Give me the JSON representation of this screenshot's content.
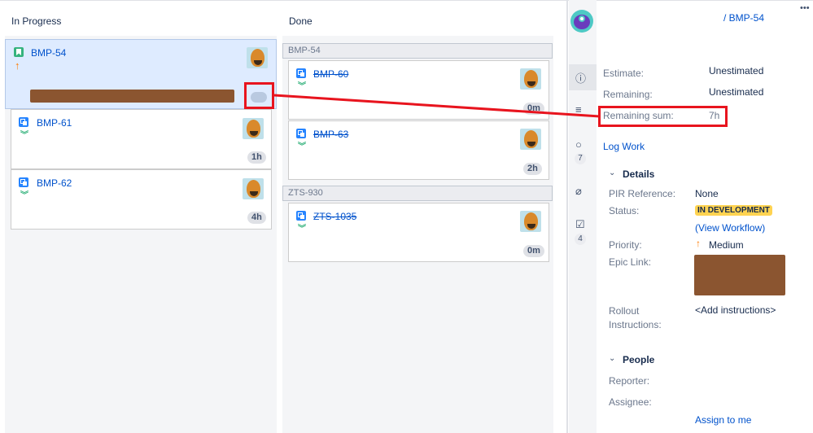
{
  "board": {
    "columns": [
      {
        "title": "In Progress"
      },
      {
        "title": "Done"
      }
    ],
    "in_progress": {
      "parent": {
        "key": "BMP-54",
        "type": "story",
        "priority": "high"
      },
      "cards": [
        {
          "key": "BMP-61",
          "estimate": "1h"
        },
        {
          "key": "BMP-62",
          "estimate": "4h"
        }
      ]
    },
    "done": {
      "groups": [
        {
          "title": "BMP-54",
          "cards": [
            {
              "key": "BMP-60",
              "estimate": "0m"
            },
            {
              "key": "BMP-63",
              "estimate": "2h"
            }
          ]
        },
        {
          "title": "ZTS-930",
          "cards": [
            {
              "key": "ZTS-1035",
              "estimate": "0m"
            }
          ]
        }
      ]
    }
  },
  "detail": {
    "breadcrumb": "/ BMP-54",
    "more": "•••",
    "estimate_label": "Estimate:",
    "estimate_value": "Unestimated",
    "remaining_label": "Remaining:",
    "remaining_value": "Unestimated",
    "remaining_sum_label": "Remaining sum:",
    "remaining_sum_value": "7h",
    "log_work": "Log Work",
    "details_heading": "Details",
    "pir_label": "PIR Reference:",
    "pir_value": "None",
    "status_label": "Status:",
    "status_value": "IN DEVELOPMENT",
    "view_workflow": "(View Workflow)",
    "priority_label": "Priority:",
    "priority_value": "Medium",
    "epic_label": "Epic Link:",
    "rollout_label": "Rollout Instructions:",
    "rollout_value": "<Add instructions>",
    "people_heading": "People",
    "reporter_label": "Reporter:",
    "assignee_label": "Assignee:",
    "assign_to_me": "Assign to me",
    "comments_count": "7",
    "subtasks_count": "4"
  },
  "colors": {
    "redaction": "#8b5530",
    "annotation": "#e8141e",
    "status_bg": "#ffd351"
  }
}
